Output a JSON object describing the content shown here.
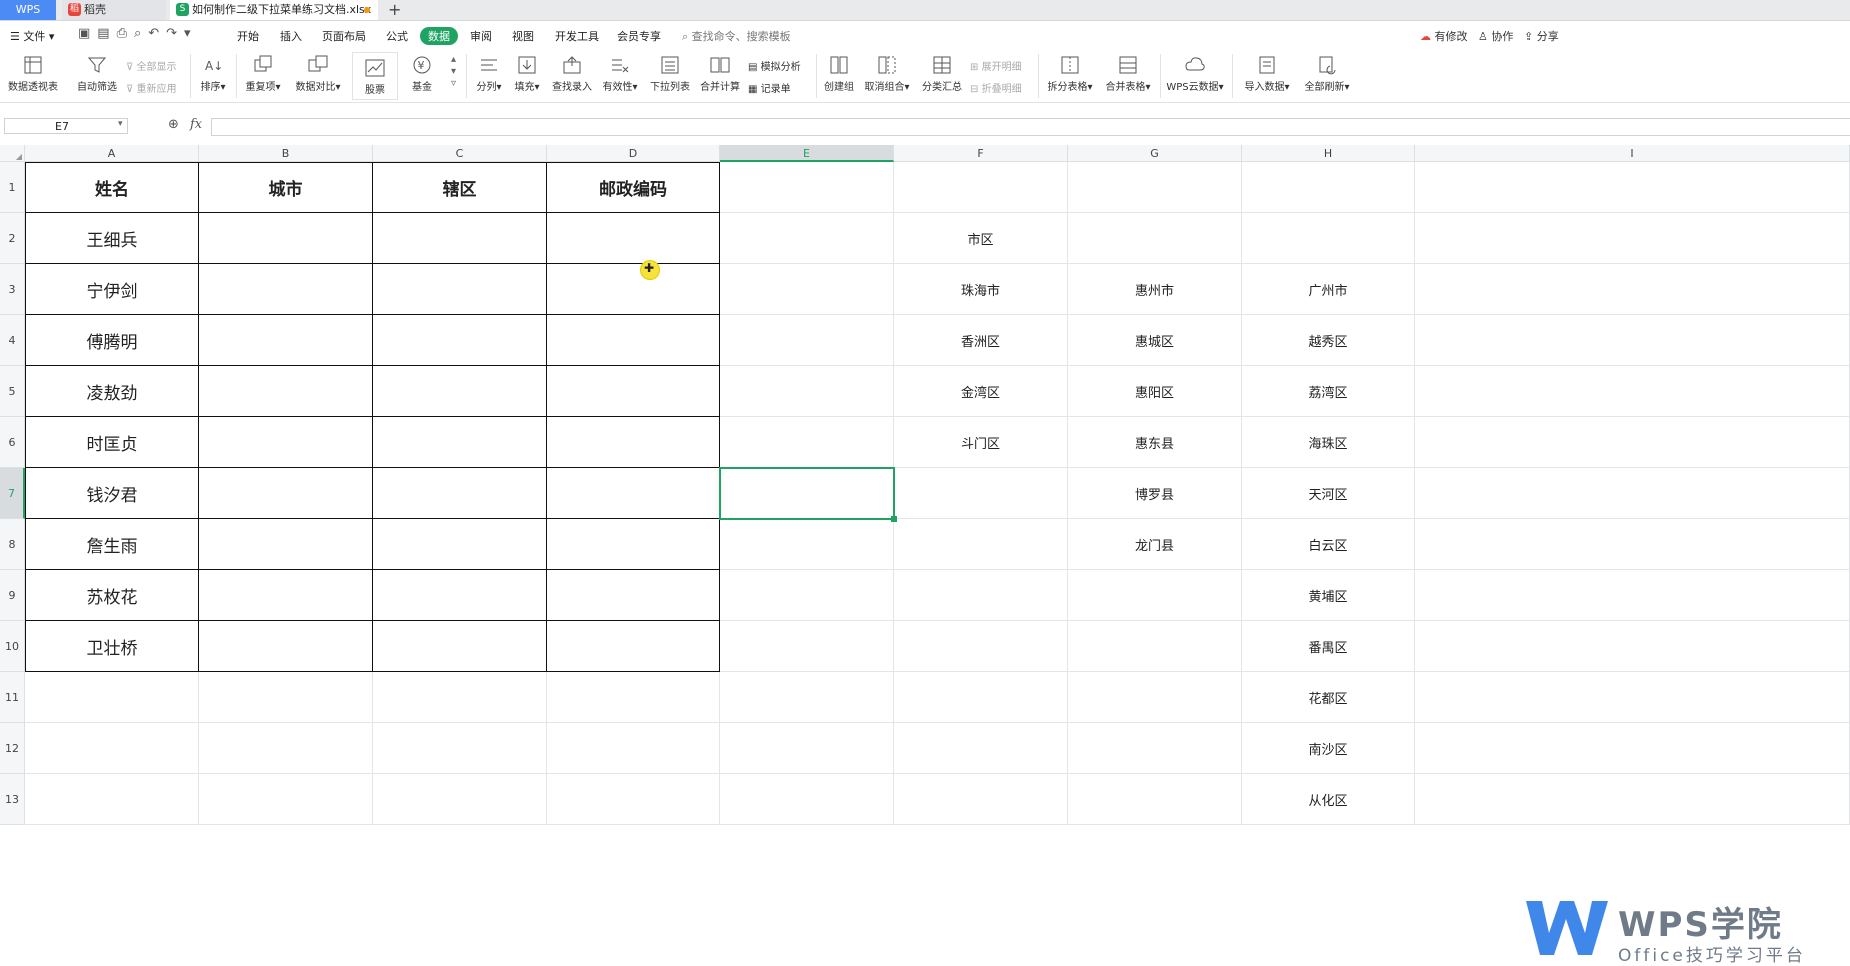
{
  "tabs": {
    "wps": "WPS",
    "daoke": "稻壳",
    "file": "如何制作二级下拉菜单练习文档.xlsx"
  },
  "menubar": {
    "file": "文件",
    "items": [
      "开始",
      "插入",
      "页面布局",
      "公式",
      "数据",
      "审阅",
      "视图",
      "开发工具",
      "会员专享"
    ],
    "active": "数据",
    "search": "查找命令、搜索模板",
    "right": [
      "有修改",
      "协作",
      "分享"
    ]
  },
  "ribbon": {
    "pivot": "数据透视表",
    "autofilter": "自动筛选",
    "show_all": "全部显示",
    "reapply": "重新应用",
    "sort": "排序",
    "duplicates": "重复项",
    "compare": "数据对比",
    "stock": "股票",
    "fund": "基金",
    "split_col": "分列",
    "fill": "填充",
    "find_entry": "查找录入",
    "validity": "有效性",
    "dropdown": "下拉列表",
    "consolidate": "合并计算",
    "simulate": "模拟分析",
    "record": "记录单",
    "group": "创建组",
    "ungroup": "取消组合",
    "subtotal": "分类汇总",
    "expand": "展开明细",
    "collapse": "折叠明细",
    "split_table": "拆分表格",
    "merge_table": "合并表格",
    "cloud": "WPS云数据",
    "import": "导入数据",
    "refresh": "全部刷新"
  },
  "formula_bar": {
    "name_box": "E7",
    "fx": "fx",
    "content": ""
  },
  "columns": [
    "A",
    "B",
    "C",
    "D",
    "E",
    "F",
    "G",
    "H",
    "I"
  ],
  "rows": [
    "1",
    "2",
    "3",
    "4",
    "5",
    "6",
    "7",
    "8",
    "9",
    "10",
    "11",
    "12",
    "13"
  ],
  "selected_cell": "E7",
  "table": {
    "headers": [
      "姓名",
      "城市",
      "辖区",
      "邮政编码"
    ],
    "names": [
      "王细兵",
      "宁伊剑",
      "傅腾明",
      "凌敖劲",
      "时匡贞",
      "钱汐君",
      "詹生雨",
      "苏枚花",
      "卫壮桥"
    ]
  },
  "lists": {
    "f2": "市区",
    "F": [
      "珠海市",
      "香洲区",
      "金湾区",
      "斗门区"
    ],
    "G": [
      "惠州市",
      "惠城区",
      "惠阳区",
      "惠东县",
      "博罗县",
      "龙门县"
    ],
    "H": [
      "广州市",
      "越秀区",
      "荔湾区",
      "海珠区",
      "天河区",
      "白云区",
      "黄埔区",
      "番禺区",
      "花都区",
      "南沙区",
      "从化区"
    ]
  },
  "watermark": {
    "brand": "WPS学院",
    "subtitle": "Office技巧学习平台"
  }
}
